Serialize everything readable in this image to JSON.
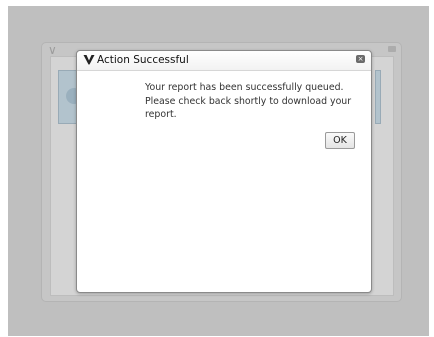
{
  "dialog": {
    "title": "Action Successful",
    "icon": "logo-check-icon",
    "close_icon": "close-icon",
    "message_lines": [
      "Your report has been successfully queued.",
      "Please check back shortly to download your",
      "report."
    ],
    "ok_label": "OK"
  },
  "colors": {
    "overlay": "#bfbfbf",
    "dialog_border": "#8a8a8a",
    "text": "#333333"
  }
}
